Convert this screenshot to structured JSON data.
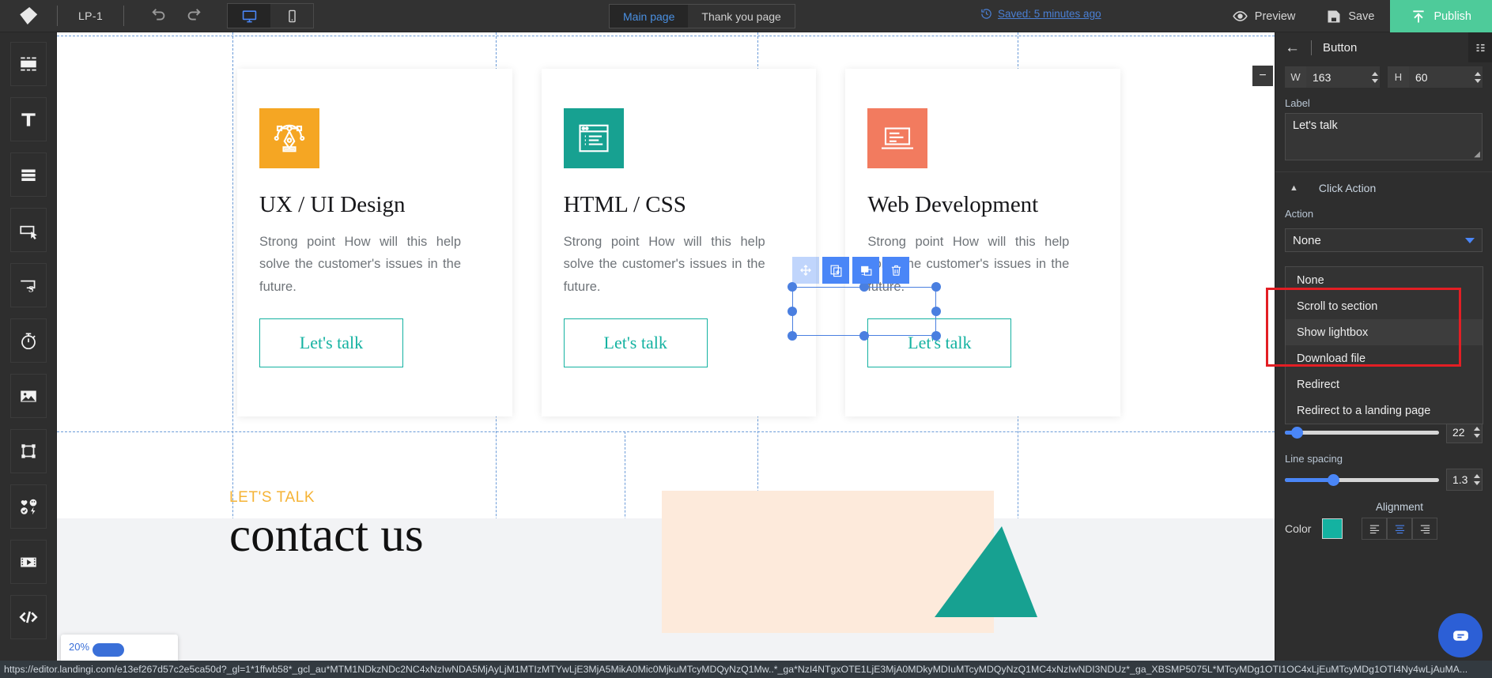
{
  "topbar": {
    "logo": "landingi-logo-icon",
    "project_name": "LP-1",
    "undo": "undo-icon",
    "redo": "redo-icon",
    "device_desktop": "desktop-icon",
    "device_mobile": "mobile-icon",
    "pages": [
      {
        "label": "Main page",
        "active": true
      },
      {
        "label": "Thank you page",
        "active": false
      }
    ],
    "saved_text": "Saved: 5 minutes ago",
    "preview_label": "Preview",
    "save_label": "Save",
    "publish_label": "Publish",
    "publish_color": "#4ecb9a"
  },
  "rail": {
    "items": [
      {
        "name": "section-icon"
      },
      {
        "name": "text-icon"
      },
      {
        "name": "box-icon"
      },
      {
        "name": "button-icon"
      },
      {
        "name": "form-icon"
      },
      {
        "name": "countdown-icon"
      },
      {
        "name": "image-icon"
      },
      {
        "name": "shape-icon"
      },
      {
        "name": "icons-icon"
      },
      {
        "name": "video-icon"
      },
      {
        "name": "code-icon"
      }
    ]
  },
  "canvas": {
    "cards": [
      {
        "icon": "pen-tool-icon",
        "icon_bg": "#f5a623",
        "title": "UX / UI Design",
        "text": "Strong point How will this help solve the customer's issues in the future.",
        "button": "Let's talk"
      },
      {
        "icon": "code-window-icon",
        "icon_bg": "#17a191",
        "title": "HTML / CSS",
        "text": "Strong point How will this help solve the customer's issues in the future.",
        "button": "Let's talk"
      },
      {
        "icon": "laptop-icon",
        "icon_bg": "#f27b5f",
        "title": "Web Development",
        "text": "Strong point How will this help solve the customer's issues in the future.",
        "button": "Let's talk"
      }
    ],
    "selection_toolbar": [
      {
        "name": "move-handle-icon"
      },
      {
        "name": "duplicate-icon"
      },
      {
        "name": "clone-style-icon"
      },
      {
        "name": "delete-icon"
      }
    ],
    "bottom_section": {
      "eyebrow": "LET'S TALK",
      "eyebrow_color": "#f5b335",
      "heading": "contact us",
      "progress_percent": "20%"
    }
  },
  "panel": {
    "title": "Button",
    "back_icon": "back-arrow-icon",
    "menu_icon": "layers-icon",
    "collapse_icon": "minus-icon",
    "width_label": "W",
    "width_value": "163",
    "height_label": "H",
    "height_value": "60",
    "label_field_label": "Label",
    "label_field_value": "Let's talk",
    "click_action_header": "Click Action",
    "action_label": "Action",
    "action_selected": "None",
    "action_options": [
      {
        "label": "None",
        "highlighted": false
      },
      {
        "label": "Scroll to section",
        "highlighted": false
      },
      {
        "label": "Show lightbox",
        "highlighted": true
      },
      {
        "label": "Download file",
        "highlighted": false
      },
      {
        "label": "Redirect",
        "highlighted": false
      },
      {
        "label": "Redirect to a landing page",
        "highlighted": false
      }
    ],
    "font_size_value": "22",
    "line_spacing_label": "Line spacing",
    "line_spacing_value": "1.3",
    "alignment_label": "Alignment",
    "color_label": "Color",
    "color_value": "#14b2a1",
    "align_options": [
      {
        "name": "align-left",
        "active": false
      },
      {
        "name": "align-center",
        "active": true
      },
      {
        "name": "align-right",
        "active": false
      }
    ],
    "chat_icon": "chat-bubble-icon"
  },
  "statusbar": {
    "url": "https://editor.landingi.com/e13ef267d57c2e5ca50d?_gl=1*1ffwb58*_gcl_au*MTM1NDkzNDc2NC4xNzIwNDA5MjAyLjM1MTIzMTYwLjE3MjA5MikA0Mic0MjkuMTcyMDQyNzQ1Mw..*_ga*NzI4NTgxOTE1LjE3MjA0MDkyMDIuMTcyMDQyNzQ1MC4xNzIwNDI3NDUz*_ga_XBSMP5075L*MTcyMDg1OTI1OC4xLjEuMTcyMDg1OTI4Ny4wLjAuMA..."
  }
}
